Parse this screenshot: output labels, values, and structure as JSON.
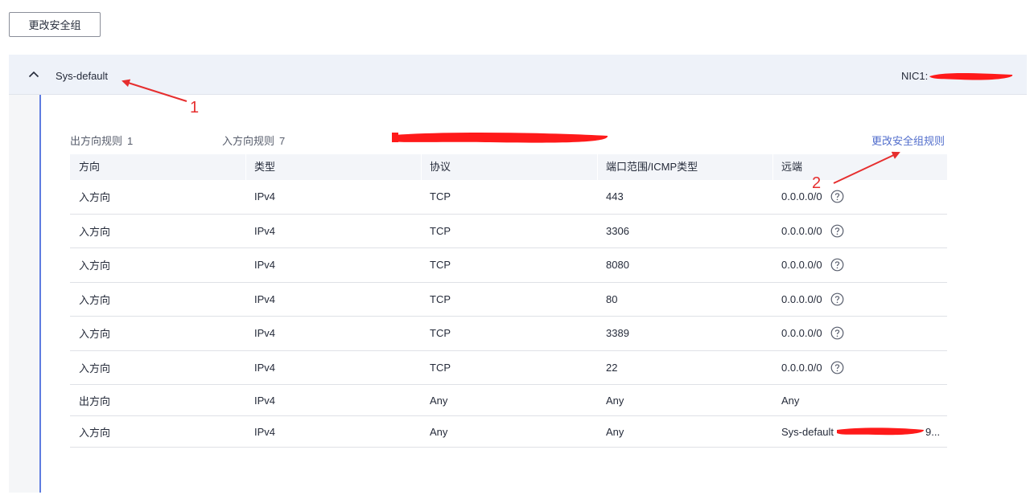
{
  "toolbar": {
    "change_sg_label": "更改安全组"
  },
  "security_group": {
    "name": "Sys-default",
    "nic_label": "NIC1: ",
    "outbound_label": "出方向规则",
    "outbound_count": "1",
    "inbound_label": "入方向规则",
    "inbound_count": "7",
    "edit_rules_link": "更改安全组规则"
  },
  "table": {
    "headers": [
      "方向",
      "类型",
      "协议",
      "端口范围/ICMP类型",
      "远端"
    ],
    "rows": [
      {
        "direction": "入方向",
        "type": "IPv4",
        "protocol": "TCP",
        "port": "443",
        "remote": "0.0.0.0/0",
        "help": true
      },
      {
        "direction": "入方向",
        "type": "IPv4",
        "protocol": "TCP",
        "port": "3306",
        "remote": "0.0.0.0/0",
        "help": true
      },
      {
        "direction": "入方向",
        "type": "IPv4",
        "protocol": "TCP",
        "port": "8080",
        "remote": "0.0.0.0/0",
        "help": true
      },
      {
        "direction": "入方向",
        "type": "IPv4",
        "protocol": "TCP",
        "port": "80",
        "remote": "0.0.0.0/0",
        "help": true
      },
      {
        "direction": "入方向",
        "type": "IPv4",
        "protocol": "TCP",
        "port": "3389",
        "remote": "0.0.0.0/0",
        "help": true
      },
      {
        "direction": "入方向",
        "type": "IPv4",
        "protocol": "TCP",
        "port": "22",
        "remote": "0.0.0.0/0",
        "help": true
      },
      {
        "direction": "出方向",
        "type": "IPv4",
        "protocol": "Any",
        "port": "Any",
        "remote": "Any",
        "help": false
      },
      {
        "direction": "入方向",
        "type": "IPv4",
        "protocol": "Any",
        "port": "Any",
        "remote": "Sys-default",
        "remote_suffix": "9...",
        "help": false
      }
    ]
  },
  "annotations": {
    "marker_1": "1",
    "marker_2": "2"
  },
  "colors": {
    "accent": "#526ecc",
    "annotation": "#e62e2e",
    "redaction": "#ff1a1a",
    "left_bar": "#5e7ce0"
  },
  "icons": {
    "collapse": "chevron-up-icon",
    "help": "help-circle-icon"
  }
}
